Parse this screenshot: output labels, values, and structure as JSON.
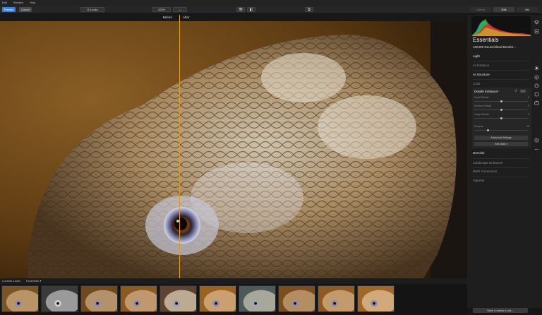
{
  "menu": [
    "Edit",
    "Window",
    "Help"
  ],
  "toolbar": {
    "presets_label": "Presets",
    "cancel_label": "Cancel",
    "looks_label": "Looks",
    "zoom_value": "100%",
    "zoom_minus": "—",
    "tabs": [
      {
        "label": "Library",
        "active": false
      },
      {
        "label": "Edit",
        "active": true
      },
      {
        "label": "Info",
        "active": false
      }
    ]
  },
  "canvas": {
    "before_label": "Before",
    "after_label": "After"
  },
  "panel": {
    "title": "Essentials",
    "filename": "150409-Deutschland-Bendor...",
    "sections": {
      "light": "Light",
      "ai_enhance": "AI Enhance",
      "ai_structure": "AI Structure",
      "color": "Color",
      "denoise": "Denoise",
      "landscape": "Landscape Enhancer",
      "bw": "B&W Conversion",
      "vignette": "Vignette"
    },
    "details": {
      "title": "Details Enhancer",
      "reset_icon": "↺",
      "sliders": [
        {
          "label": "Small Details",
          "value": "0",
          "fraction": 0.5
        },
        {
          "label": "Medium Details",
          "value": "0",
          "fraction": 0.5
        },
        {
          "label": "Large Details",
          "value": "0",
          "fraction": 0.5
        },
        {
          "label": "Sharpen",
          "value": "25",
          "fraction": 0.25
        }
      ],
      "advanced_label": "Advanced Settings",
      "mask_label": "Edit Mask ▾"
    }
  },
  "bottom": {
    "looks_label": "Luminar Looks",
    "collection_label": "Essentials ▾",
    "save_label": "Save Luminar Look..."
  },
  "colors": {
    "accent_blue": "#3b82d6",
    "split_line": "#e09a22"
  },
  "icons": [
    "layers-icon",
    "export-icon",
    "sun-icon",
    "palette-icon",
    "face-icon",
    "portrait-icon",
    "briefcase-icon",
    "history-icon",
    "more-icon"
  ]
}
